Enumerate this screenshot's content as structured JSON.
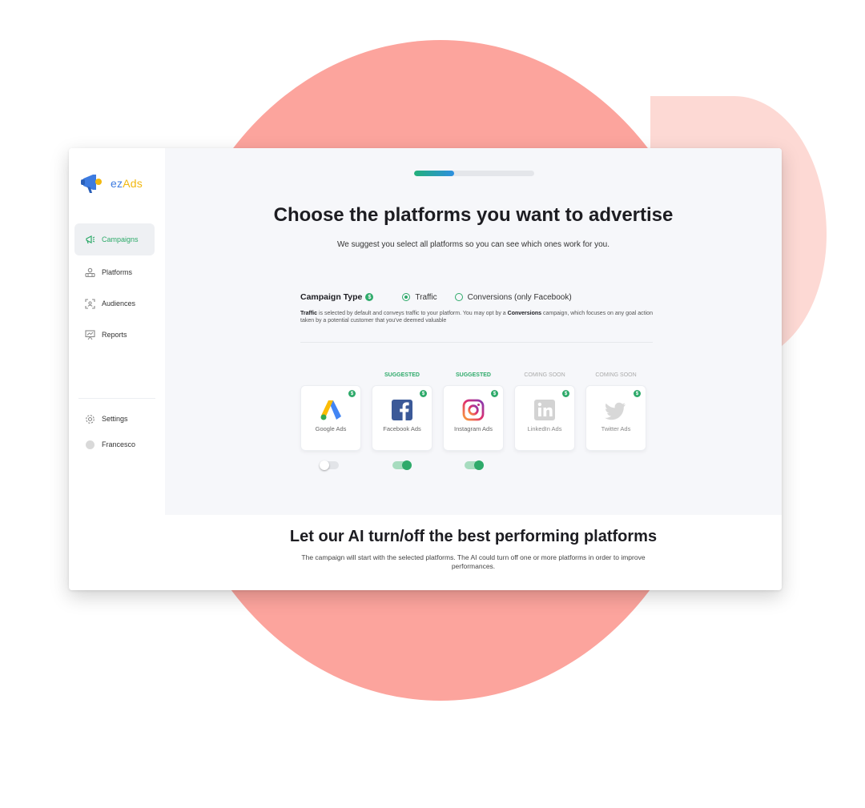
{
  "brand": {
    "name_part1": "ez",
    "name_part2": "Ads"
  },
  "sidebar": {
    "items": [
      {
        "label": "Campaigns",
        "icon": "megaphone-icon",
        "active": true
      },
      {
        "label": "Platforms",
        "icon": "platforms-icon"
      },
      {
        "label": "Audiences",
        "icon": "audience-icon"
      },
      {
        "label": "Reports",
        "icon": "reports-icon"
      }
    ],
    "bottom_items": [
      {
        "label": "Settings",
        "icon": "gear-icon"
      },
      {
        "label": "Francesco",
        "icon": "avatar"
      }
    ]
  },
  "progress": {
    "value": 0.33
  },
  "main": {
    "title": "Choose the platforms you want to advertise",
    "subtitle": "We suggest you select all platforms so you can see which ones work for you.",
    "campaign_type": {
      "label": "Campaign Type",
      "options": [
        {
          "label": "Traffic",
          "selected": true
        },
        {
          "label": "Conversions (only Facebook)",
          "selected": false
        }
      ],
      "desc_bold1": "Traffic",
      "desc_part1": " is selected by default and conveys traffic to your platform. You may opt by a ",
      "desc_bold2": "Conversions",
      "desc_part2": " campaign, which focuses on any goal action taken by a potential customer that you've deemed valuable"
    },
    "platforms": [
      {
        "tag": "",
        "name": "Google Ads",
        "enabled": false
      },
      {
        "tag": "SUGGESTED",
        "name": "Facebook Ads",
        "enabled": true
      },
      {
        "tag": "SUGGESTED",
        "name": "Instagram Ads",
        "enabled": true
      },
      {
        "tag": "COMING SOON",
        "name": "LinkedIn Ads",
        "enabled": false
      },
      {
        "tag": "COMING SOON",
        "name": "Twitter Ads",
        "enabled": false
      }
    ]
  },
  "bottom": {
    "title": "Let our AI turn/off the best performing platforms",
    "description": "The campaign will start with the selected platforms. The AI could turn off one or more platforms in order to improve performances."
  },
  "colors": {
    "accent": "#2eaa6a",
    "brand_blue": "#3d7be0",
    "brand_yellow": "#f2b80f",
    "backdrop": "#fca49d"
  }
}
